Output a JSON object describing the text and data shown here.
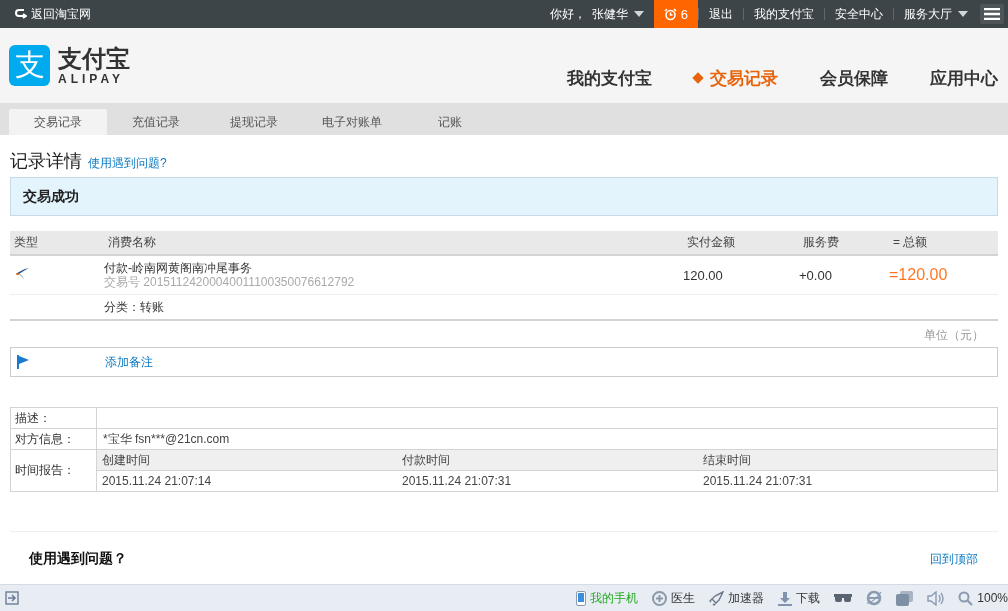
{
  "topbar": {
    "back_link": "返回淘宝网",
    "greeting": "你好，",
    "user": "张健华",
    "notifications": "6",
    "links": [
      "退出",
      "我的支付宝",
      "安全中心"
    ],
    "service": "服务大厅"
  },
  "logo": {
    "mark": "支",
    "name": "支付宝",
    "latin": "ALIPAY"
  },
  "main_nav": [
    {
      "label": "我的支付宝",
      "selected": false
    },
    {
      "label": "交易记录",
      "selected": true
    },
    {
      "label": "会员保障",
      "selected": false
    },
    {
      "label": "应用中心",
      "selected": false
    }
  ],
  "sub_nav": [
    {
      "label": "交易记录",
      "selected": true
    },
    {
      "label": "充值记录",
      "selected": false
    },
    {
      "label": "提现记录",
      "selected": false
    },
    {
      "label": "电子对账单",
      "selected": false
    },
    {
      "label": "记账",
      "selected": false
    }
  ],
  "page": {
    "title": "记录详情",
    "help_link": "使用遇到问题?"
  },
  "status": "交易成功",
  "table": {
    "columns": [
      "类型",
      "消费名称",
      "实付金额",
      "服务费",
      "= 总额"
    ],
    "rows": [
      {
        "name": "付款-岭南网黄阁南冲尾事务",
        "trade_no_label": "交易号",
        "trade_no": "20151124200040011100350076612792",
        "paid": "120.00",
        "fee": "+0.00",
        "total": "=120.00",
        "category": "分类：转账"
      }
    ]
  },
  "unit": "单位（元）",
  "note_link": "添加备注",
  "details": {
    "description_label": "描述：",
    "counterpart_label": "对方信息：",
    "counterpart": "*宝华 fsn***@21cn.com",
    "time_label": "时间报告：",
    "times": [
      {
        "label": "创建时间",
        "value": "2015.11.24 21:07:14"
      },
      {
        "label": "付款时间",
        "value": "2015.11.24 21:07:31"
      },
      {
        "label": "结束时间",
        "value": "2015.11.24 21:07:31"
      }
    ]
  },
  "footer": {
    "help_title": "使用遇到问题？",
    "back_to_top": "回到顶部"
  },
  "status_bar": {
    "items": [
      {
        "kind": "phone",
        "label": "我的手机"
      },
      {
        "kind": "doctor",
        "label": "医生"
      },
      {
        "kind": "rocket",
        "label": "加速器"
      },
      {
        "kind": "download",
        "label": "下载"
      },
      {
        "kind": "glasses"
      },
      {
        "kind": "browser"
      },
      {
        "kind": "windows"
      },
      {
        "kind": "speaker"
      },
      {
        "kind": "zoom",
        "label": "100%"
      }
    ]
  }
}
